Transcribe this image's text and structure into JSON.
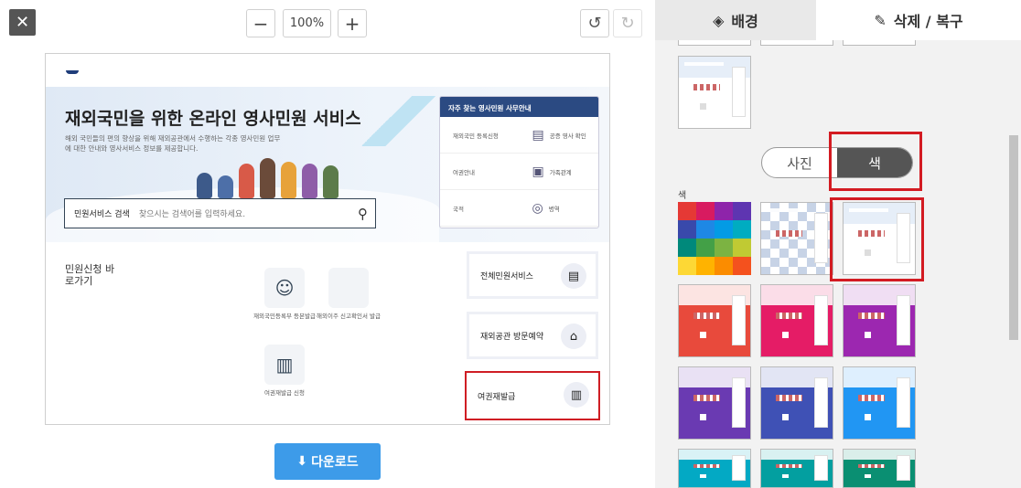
{
  "toolbar": {
    "close": "✕",
    "zoom_out": "−",
    "zoom_level": "100%",
    "zoom_in": "+",
    "undo": "↺",
    "redo": "↻"
  },
  "preview": {
    "hero_title": "재외국민을 위한 온라인 영사민원 서비스",
    "hero_sub": "해외 국민들의 편의 향상을 위해 재외공관에서 수행하는 각종 영사민원 업무에 대한 안내와 영사서비스 정보를 제공합니다.",
    "search_label": "민원서비스 검색",
    "search_placeholder": "찾으시는 검색어를 입력하세요.",
    "office_title": "자주 찾는 영사민원 사무안내",
    "office_items": [
      "재외국민 등록신청",
      "공증 영사 확인",
      "여권안내",
      "가족관계",
      "국적",
      "병역"
    ],
    "quick_title": "민원신청 바로가기",
    "quick_items": [
      "재외국민등록부 등본발급",
      "해외이주 신고확인서 발급",
      "여권재발급 신청"
    ],
    "services": [
      "전체민원서비스",
      "재외공관 방문예약",
      "여권재발급"
    ]
  },
  "download_label": "다운로드",
  "panel": {
    "tab_background": "배경",
    "tab_delete": "삭제 / 복구",
    "seg_photo": "사진",
    "seg_color": "색",
    "color_label": "색"
  },
  "colors": {
    "accent": "#3d9be9",
    "highlight": "#d31b22",
    "theme_thumbs": [
      "#e84a3c",
      "#e51c66",
      "#9c27b0",
      "#6a3ab2",
      "#3f51b5",
      "#2196f3",
      "#03a9c4",
      "#039fa0",
      "#0a8f72"
    ],
    "palette": [
      "#e53935",
      "#d81b60",
      "#8e24aa",
      "#5e35b1",
      "#3949ab",
      "#1e88e5",
      "#039be5",
      "#00acc1",
      "#00897b",
      "#43a047",
      "#7cb342",
      "#c0ca33",
      "#fdd835",
      "#ffb300",
      "#fb8c00",
      "#f4511e"
    ]
  }
}
